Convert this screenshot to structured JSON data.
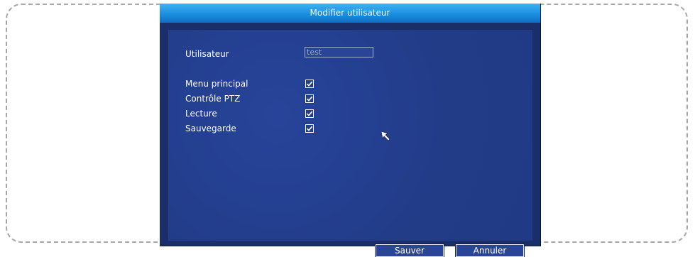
{
  "dialog": {
    "title": "Modifier utilisateur",
    "user_label": "Utilisateur",
    "user_value": "test",
    "permissions": [
      {
        "label": "Menu principal",
        "checked": true
      },
      {
        "label": "Contrôle PTZ",
        "checked": true
      },
      {
        "label": "Lecture",
        "checked": true
      },
      {
        "label": "Sauvegarde",
        "checked": true
      }
    ],
    "save_label": "Sauver",
    "cancel_label": "Annuler"
  },
  "colors": {
    "title_bar": "#1a8fe0",
    "panel": "#233f8e",
    "text": "#ffffff"
  }
}
